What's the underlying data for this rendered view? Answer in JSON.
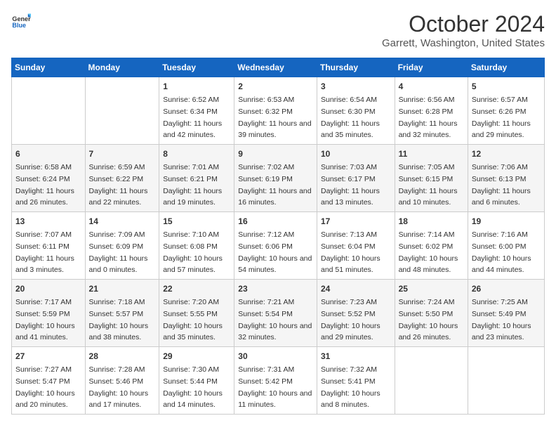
{
  "header": {
    "logo_general": "General",
    "logo_blue": "Blue",
    "month": "October 2024",
    "location": "Garrett, Washington, United States"
  },
  "days_of_week": [
    "Sunday",
    "Monday",
    "Tuesday",
    "Wednesday",
    "Thursday",
    "Friday",
    "Saturday"
  ],
  "weeks": [
    [
      {
        "day": "",
        "sunrise": "",
        "sunset": "",
        "daylight": ""
      },
      {
        "day": "",
        "sunrise": "",
        "sunset": "",
        "daylight": ""
      },
      {
        "day": "1",
        "sunrise": "Sunrise: 6:52 AM",
        "sunset": "Sunset: 6:34 PM",
        "daylight": "Daylight: 11 hours and 42 minutes."
      },
      {
        "day": "2",
        "sunrise": "Sunrise: 6:53 AM",
        "sunset": "Sunset: 6:32 PM",
        "daylight": "Daylight: 11 hours and 39 minutes."
      },
      {
        "day": "3",
        "sunrise": "Sunrise: 6:54 AM",
        "sunset": "Sunset: 6:30 PM",
        "daylight": "Daylight: 11 hours and 35 minutes."
      },
      {
        "day": "4",
        "sunrise": "Sunrise: 6:56 AM",
        "sunset": "Sunset: 6:28 PM",
        "daylight": "Daylight: 11 hours and 32 minutes."
      },
      {
        "day": "5",
        "sunrise": "Sunrise: 6:57 AM",
        "sunset": "Sunset: 6:26 PM",
        "daylight": "Daylight: 11 hours and 29 minutes."
      }
    ],
    [
      {
        "day": "6",
        "sunrise": "Sunrise: 6:58 AM",
        "sunset": "Sunset: 6:24 PM",
        "daylight": "Daylight: 11 hours and 26 minutes."
      },
      {
        "day": "7",
        "sunrise": "Sunrise: 6:59 AM",
        "sunset": "Sunset: 6:22 PM",
        "daylight": "Daylight: 11 hours and 22 minutes."
      },
      {
        "day": "8",
        "sunrise": "Sunrise: 7:01 AM",
        "sunset": "Sunset: 6:21 PM",
        "daylight": "Daylight: 11 hours and 19 minutes."
      },
      {
        "day": "9",
        "sunrise": "Sunrise: 7:02 AM",
        "sunset": "Sunset: 6:19 PM",
        "daylight": "Daylight: 11 hours and 16 minutes."
      },
      {
        "day": "10",
        "sunrise": "Sunrise: 7:03 AM",
        "sunset": "Sunset: 6:17 PM",
        "daylight": "Daylight: 11 hours and 13 minutes."
      },
      {
        "day": "11",
        "sunrise": "Sunrise: 7:05 AM",
        "sunset": "Sunset: 6:15 PM",
        "daylight": "Daylight: 11 hours and 10 minutes."
      },
      {
        "day": "12",
        "sunrise": "Sunrise: 7:06 AM",
        "sunset": "Sunset: 6:13 PM",
        "daylight": "Daylight: 11 hours and 6 minutes."
      }
    ],
    [
      {
        "day": "13",
        "sunrise": "Sunrise: 7:07 AM",
        "sunset": "Sunset: 6:11 PM",
        "daylight": "Daylight: 11 hours and 3 minutes."
      },
      {
        "day": "14",
        "sunrise": "Sunrise: 7:09 AM",
        "sunset": "Sunset: 6:09 PM",
        "daylight": "Daylight: 11 hours and 0 minutes."
      },
      {
        "day": "15",
        "sunrise": "Sunrise: 7:10 AM",
        "sunset": "Sunset: 6:08 PM",
        "daylight": "Daylight: 10 hours and 57 minutes."
      },
      {
        "day": "16",
        "sunrise": "Sunrise: 7:12 AM",
        "sunset": "Sunset: 6:06 PM",
        "daylight": "Daylight: 10 hours and 54 minutes."
      },
      {
        "day": "17",
        "sunrise": "Sunrise: 7:13 AM",
        "sunset": "Sunset: 6:04 PM",
        "daylight": "Daylight: 10 hours and 51 minutes."
      },
      {
        "day": "18",
        "sunrise": "Sunrise: 7:14 AM",
        "sunset": "Sunset: 6:02 PM",
        "daylight": "Daylight: 10 hours and 48 minutes."
      },
      {
        "day": "19",
        "sunrise": "Sunrise: 7:16 AM",
        "sunset": "Sunset: 6:00 PM",
        "daylight": "Daylight: 10 hours and 44 minutes."
      }
    ],
    [
      {
        "day": "20",
        "sunrise": "Sunrise: 7:17 AM",
        "sunset": "Sunset: 5:59 PM",
        "daylight": "Daylight: 10 hours and 41 minutes."
      },
      {
        "day": "21",
        "sunrise": "Sunrise: 7:18 AM",
        "sunset": "Sunset: 5:57 PM",
        "daylight": "Daylight: 10 hours and 38 minutes."
      },
      {
        "day": "22",
        "sunrise": "Sunrise: 7:20 AM",
        "sunset": "Sunset: 5:55 PM",
        "daylight": "Daylight: 10 hours and 35 minutes."
      },
      {
        "day": "23",
        "sunrise": "Sunrise: 7:21 AM",
        "sunset": "Sunset: 5:54 PM",
        "daylight": "Daylight: 10 hours and 32 minutes."
      },
      {
        "day": "24",
        "sunrise": "Sunrise: 7:23 AM",
        "sunset": "Sunset: 5:52 PM",
        "daylight": "Daylight: 10 hours and 29 minutes."
      },
      {
        "day": "25",
        "sunrise": "Sunrise: 7:24 AM",
        "sunset": "Sunset: 5:50 PM",
        "daylight": "Daylight: 10 hours and 26 minutes."
      },
      {
        "day": "26",
        "sunrise": "Sunrise: 7:25 AM",
        "sunset": "Sunset: 5:49 PM",
        "daylight": "Daylight: 10 hours and 23 minutes."
      }
    ],
    [
      {
        "day": "27",
        "sunrise": "Sunrise: 7:27 AM",
        "sunset": "Sunset: 5:47 PM",
        "daylight": "Daylight: 10 hours and 20 minutes."
      },
      {
        "day": "28",
        "sunrise": "Sunrise: 7:28 AM",
        "sunset": "Sunset: 5:46 PM",
        "daylight": "Daylight: 10 hours and 17 minutes."
      },
      {
        "day": "29",
        "sunrise": "Sunrise: 7:30 AM",
        "sunset": "Sunset: 5:44 PM",
        "daylight": "Daylight: 10 hours and 14 minutes."
      },
      {
        "day": "30",
        "sunrise": "Sunrise: 7:31 AM",
        "sunset": "Sunset: 5:42 PM",
        "daylight": "Daylight: 10 hours and 11 minutes."
      },
      {
        "day": "31",
        "sunrise": "Sunrise: 7:32 AM",
        "sunset": "Sunset: 5:41 PM",
        "daylight": "Daylight: 10 hours and 8 minutes."
      },
      {
        "day": "",
        "sunrise": "",
        "sunset": "",
        "daylight": ""
      },
      {
        "day": "",
        "sunrise": "",
        "sunset": "",
        "daylight": ""
      }
    ]
  ]
}
